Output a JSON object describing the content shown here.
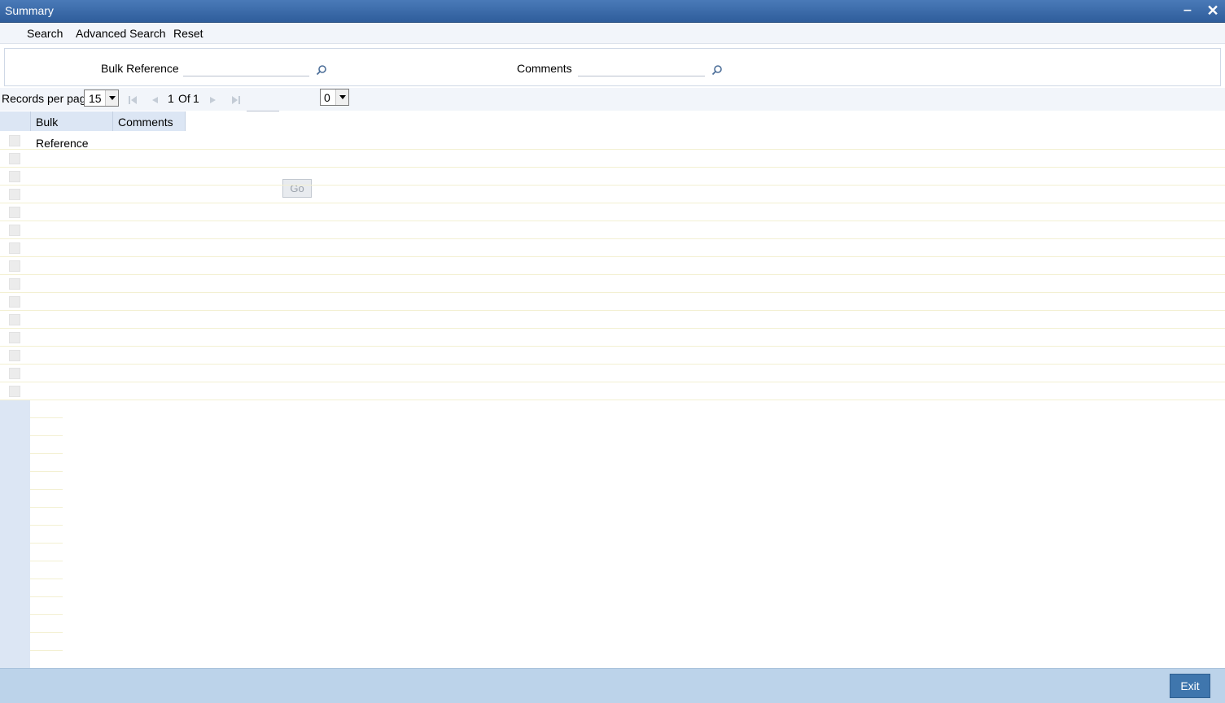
{
  "window": {
    "title": "Summary"
  },
  "toolbar": {
    "search": "Search",
    "advanced_search": "Advanced Search",
    "reset": "Reset"
  },
  "search_panel": {
    "bulk_reference_label": "Bulk Reference",
    "comments_label": "Comments"
  },
  "pager": {
    "records_per_page_label": "Records per page",
    "records_per_page_value": "15",
    "current_page": "1",
    "of_label": "Of",
    "total_pages": "1",
    "go_label": "Go",
    "selector_value": "0"
  },
  "grid": {
    "columns": [
      "Bulk Reference",
      "Comments"
    ]
  },
  "footer": {
    "exit_label": "Exit"
  }
}
